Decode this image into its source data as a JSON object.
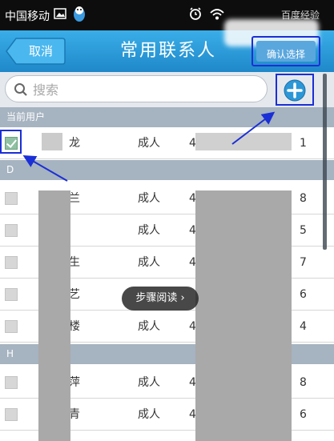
{
  "status_bar": {
    "carrier": "中国移动",
    "obscured_text": "百度经验"
  },
  "title_bar": {
    "cancel_label": "取消",
    "title": "常用联系人",
    "confirm_label": "确认选择"
  },
  "search": {
    "placeholder": "搜索"
  },
  "sections": [
    {
      "header": "当前用户",
      "rows": [
        {
          "name": "龙",
          "type": "成人",
          "id_start": "4",
          "id_end": "1",
          "checked": true
        }
      ]
    },
    {
      "header": "D",
      "rows": [
        {
          "name": "兰",
          "type": "成人",
          "id_start": "4",
          "id_end": "8",
          "checked": false
        },
        {
          "name": "",
          "type": "成人",
          "id_start": "4",
          "id_end": "5",
          "checked": false
        },
        {
          "name": "生",
          "type": "成人",
          "id_start": "4",
          "id_end": "7",
          "checked": false
        },
        {
          "name": "艺",
          "type": "",
          "id_start": "",
          "id_end": "6",
          "checked": false
        },
        {
          "name": "楼",
          "type": "成人",
          "id_start": "4",
          "id_end": "4",
          "checked": false
        }
      ]
    },
    {
      "header": "H",
      "rows": [
        {
          "name": "萍",
          "type": "成人",
          "id_start": "4",
          "id_end": "8",
          "checked": false
        },
        {
          "name": "青",
          "type": "成人",
          "id_start": "4",
          "id_end": "6",
          "checked": false
        }
      ]
    }
  ],
  "toast": {
    "label": "步骤阅读",
    "chevron": "›"
  },
  "colors": {
    "title_bar": "#2a9bd9",
    "section_header": "#a6b3c0",
    "annotation": "#1b2fd6"
  }
}
